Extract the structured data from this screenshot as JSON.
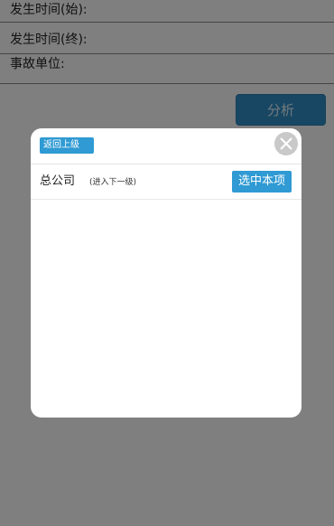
{
  "form": {
    "start_time_label": "发生时间(始):",
    "end_time_label": "发生时间(终):",
    "unit_label": "事故单位:",
    "analyze_button": "分析"
  },
  "modal": {
    "back_button": "返回上级",
    "items": [
      {
        "name": "总公司",
        "next_level": "(进入下一级)",
        "select_button": "选中本项"
      }
    ]
  },
  "colors": {
    "accent": "#2f9ad3",
    "overlay": "rgba(0,0,0,0.5)"
  },
  "icons": {
    "close": "close-icon"
  }
}
